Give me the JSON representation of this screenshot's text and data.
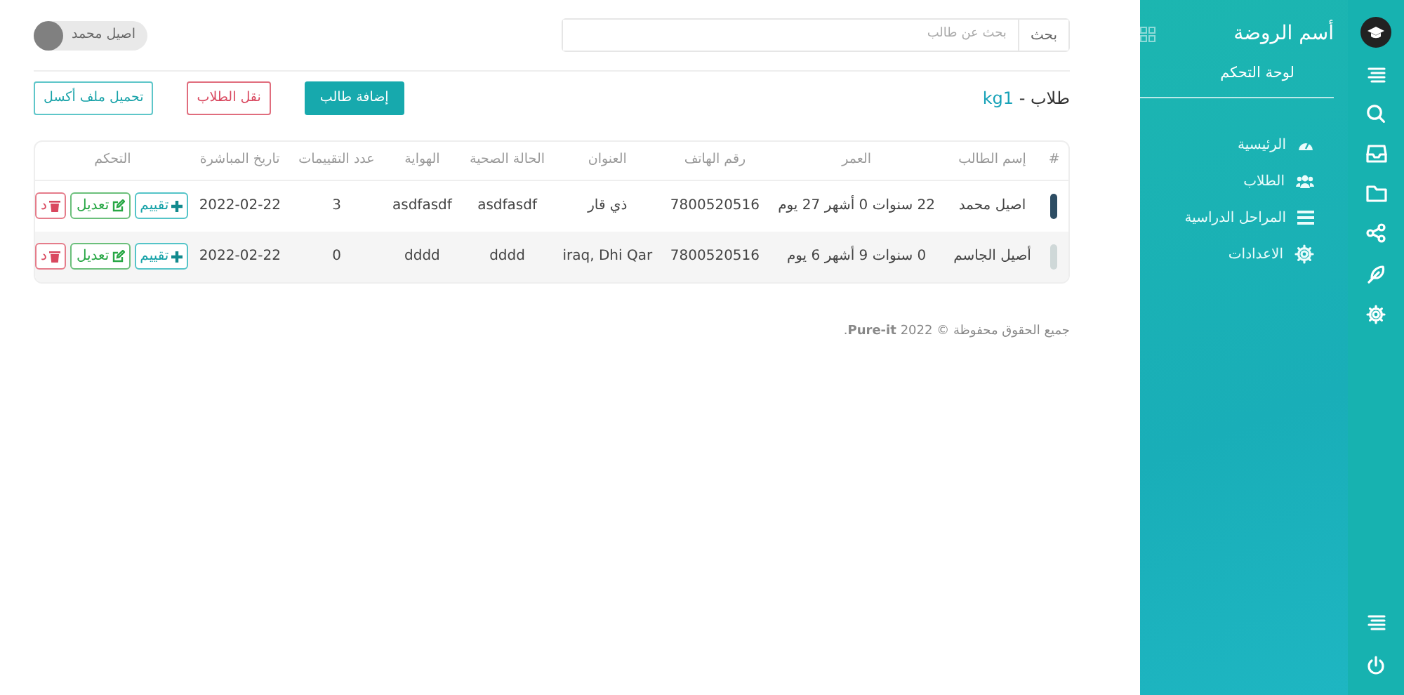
{
  "search": {
    "button": "بحث",
    "placeholder": "بحث عن طالب"
  },
  "user": {
    "name": "اصيل محمد"
  },
  "page_title": {
    "label": "طلاب - ",
    "group": "kg1"
  },
  "actions": [
    {
      "label": "إضافة طالب",
      "kind": "primary"
    },
    {
      "label": "نقل الطلاب",
      "kind": "danger"
    },
    {
      "label": "تحميل ملف أكسل",
      "kind": "info"
    }
  ],
  "table": {
    "columns": [
      "#",
      "إسم الطالب",
      "العمر",
      "رقم الهاتف",
      "العنوان",
      "الحالة الصحية",
      "الهواية",
      "عدد التقييمات",
      "تاريخ المباشرة",
      "التحكم"
    ],
    "rows": [
      {
        "cells": [
          "",
          "اصيل محمد",
          "22 سنوات 0 أشهر 27 يوم",
          "7800520516",
          "ذي قار",
          "asdfasdf",
          "asdfasdf",
          "3",
          "2022-02-22"
        ],
        "buttons": [
          {
            "label": "تقييم",
            "kind": "rate"
          },
          {
            "label": "تعديل",
            "kind": "edit"
          },
          {
            "label": "د",
            "kind": "delete"
          }
        ]
      },
      {
        "cells": [
          "",
          "أصيل الجاسم",
          "0 سنوات 9 أشهر 6 يوم",
          "7800520516",
          "iraq, Dhi Qar",
          "dddd",
          "dddd",
          "0",
          "2022-02-22"
        ],
        "buttons": [
          {
            "label": "تقييم",
            "kind": "rate"
          },
          {
            "label": "تعديل",
            "kind": "edit"
          },
          {
            "label": "د",
            "kind": "delete"
          }
        ]
      }
    ]
  },
  "footer": "جميع الحقوق محفوظة © 2022 **Pure-it**.",
  "sidebar": {
    "title": "أسم الروضة",
    "subtitle": "لوحة التحكم",
    "items": [
      {
        "label": "الرئيسية"
      },
      {
        "label": "الطلاب"
      },
      {
        "label": "المراحل الدراسية"
      },
      {
        "label": "الاعدادات"
      }
    ]
  }
}
